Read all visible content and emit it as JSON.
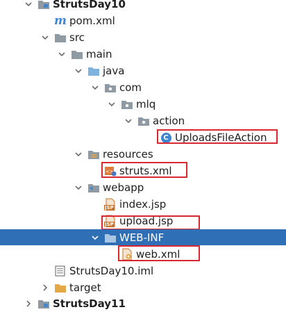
{
  "tree": {
    "project": "StrutsDay10",
    "pom": "pom.xml",
    "src": "src",
    "main": "main",
    "java": "java",
    "com": "com",
    "mlq": "mlq",
    "action": "action",
    "uploads_file_action": "UploadsFileAction",
    "resources": "resources",
    "struts": "struts.xml",
    "webapp": "webapp",
    "index": "index.jsp",
    "upload": "upload.jsp",
    "web_inf": "WEB-INF",
    "web_xml": "web.xml",
    "iml": "StrutsDay10.iml",
    "target": "target",
    "next_project": "StrutsDay11",
    "jsp_badge": "JSP",
    "class_badge": "C",
    "maven_badge": "m"
  },
  "colors": {
    "selection": "#2f6fb5",
    "highlight_box": "#d9282f",
    "folder_blue": "#7fb3df",
    "folder_gray": "#8f9aa3",
    "folder_orange": "#e4a847",
    "class_icon": "#3f86cf"
  },
  "icons": {
    "expanded": "chevron-down-icon",
    "collapsed": "chevron-right-icon"
  }
}
